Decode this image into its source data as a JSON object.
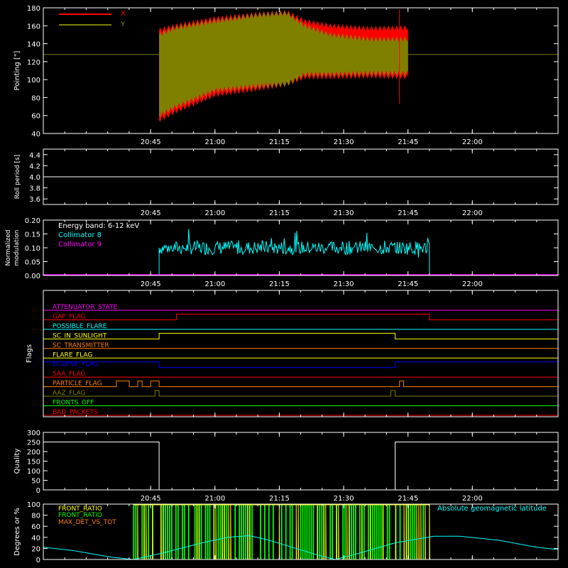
{
  "time_ticks": [
    "20:45",
    "21:00",
    "21:15",
    "21:30",
    "21:45",
    "22:00"
  ],
  "colors": {
    "axis": "#ffffff",
    "pointing_x": "#ff0000",
    "pointing_y": "#808000",
    "collimator_8": "#00ffff",
    "collimator_9": "#ff00ff",
    "front_ratio": "#ffff00",
    "front_ratio_2": "#00ff00",
    "max_det": "#ff8000",
    "geomag": "#00ffff"
  },
  "chart_data": [
    {
      "type": "area",
      "ylabel": "Pointing [\"]",
      "ylim": [
        40,
        180
      ],
      "yticks": [
        "40",
        "60",
        "80",
        "100",
        "120",
        "140",
        "160",
        "180"
      ],
      "legend": [
        "X",
        "Y"
      ],
      "series": [
        {
          "name": "X",
          "envelope_upper": [
            [
              20.783,
              155
            ],
            [
              20.85,
              160
            ],
            [
              21.0,
              168
            ],
            [
              21.17,
              173
            ],
            [
              21.28,
              175
            ],
            [
              21.35,
              165
            ],
            [
              21.45,
              160
            ],
            [
              21.6,
              157
            ],
            [
              21.75,
              158
            ]
          ],
          "envelope_lower": [
            [
              20.783,
              55
            ],
            [
              20.85,
              65
            ],
            [
              21.0,
              83
            ],
            [
              21.17,
              90
            ],
            [
              21.28,
              95
            ],
            [
              21.35,
              103
            ],
            [
              21.45,
              103
            ],
            [
              21.6,
              104
            ],
            [
              21.75,
              103
            ]
          ]
        },
        {
          "name": "Y",
          "envelope_upper": [
            [
              20.783,
              150
            ],
            [
              20.85,
              158
            ],
            [
              21.0,
              165
            ],
            [
              21.17,
              172
            ],
            [
              21.28,
              174
            ],
            [
              21.35,
              160
            ],
            [
              21.45,
              150
            ],
            [
              21.6,
              145
            ],
            [
              21.75,
              145
            ]
          ],
          "envelope_lower": [
            [
              20.783,
              60
            ],
            [
              20.85,
              70
            ],
            [
              21.0,
              88
            ],
            [
              21.17,
              93
            ],
            [
              21.28,
              95
            ],
            [
              21.35,
              106
            ],
            [
              21.45,
              106
            ],
            [
              21.6,
              107
            ],
            [
              21.75,
              107
            ]
          ]
        }
      ],
      "baseline": 128
    },
    {
      "type": "line",
      "ylabel": "Roll period [s]",
      "ylim": [
        3.5,
        4.5
      ],
      "yticks": [
        "3.6",
        "3.8",
        "4.0",
        "4.2",
        "4.4"
      ],
      "value": 4.0
    },
    {
      "type": "line",
      "ylabel": "Normalized modulation",
      "ylim": [
        0.0,
        0.2
      ],
      "yticks": [
        "0.00",
        "0.05",
        "0.10",
        "0.15",
        "0.20"
      ],
      "annotation": "Energy band: 6-12 keV",
      "legend": [
        "Collimator 8",
        "Collimator 9"
      ],
      "range": [
        20.783,
        21.833
      ],
      "mean": 0.1
    },
    {
      "type": "line",
      "ylabel": "Flags",
      "flags": [
        {
          "name": "ATTENUATOR_STATE",
          "color": "#ff00ff",
          "segments": [
            [
              20.333,
              0
            ],
            [
              22.333,
              0
            ]
          ]
        },
        {
          "name": "GAP_FLAG",
          "color": "#ff0000",
          "segments": [
            [
              20.333,
              0
            ],
            [
              20.85,
              0
            ],
            [
              20.85,
              1
            ],
            [
              21.833,
              1
            ],
            [
              21.833,
              0
            ],
            [
              22.333,
              0
            ]
          ]
        },
        {
          "name": "POSSIBLE_FLARE",
          "color": "#00ffff",
          "segments": [
            [
              20.333,
              0
            ],
            [
              22.333,
              0
            ]
          ]
        },
        {
          "name": "SC_IN_SUNLIGHT",
          "color": "#ffff00",
          "segments": [
            [
              20.333,
              0
            ],
            [
              20.783,
              0
            ],
            [
              20.783,
              1
            ],
            [
              21.7,
              1
            ],
            [
              21.7,
              0
            ],
            [
              22.333,
              0
            ]
          ]
        },
        {
          "name": "SC_TRANSMITTER",
          "color": "#ff8000",
          "segments": [
            [
              20.333,
              0
            ],
            [
              22.333,
              0
            ]
          ]
        },
        {
          "name": "FLARE_FLAG",
          "color": "#ffff00",
          "segments": [
            [
              20.333,
              0
            ],
            [
              22.333,
              0
            ]
          ]
        },
        {
          "name": "ECLIPSE_FLAG",
          "color": "#0000ff",
          "segments": [
            [
              20.333,
              1
            ],
            [
              20.783,
              1
            ],
            [
              20.783,
              0
            ],
            [
              21.7,
              0
            ],
            [
              21.7,
              1
            ],
            [
              22.333,
              1
            ]
          ]
        },
        {
          "name": "SAA_FLAG",
          "color": "#ff0000",
          "segments": [
            [
              20.333,
              0
            ],
            [
              22.333,
              0
            ]
          ]
        },
        {
          "name": "PARTICLE_FLAG",
          "color": "#ff8000",
          "segments": [
            [
              20.333,
              0
            ],
            [
              20.617,
              0
            ],
            [
              20.617,
              1
            ],
            [
              20.667,
              1
            ],
            [
              20.667,
              0
            ],
            [
              20.7,
              0
            ],
            [
              20.7,
              1
            ],
            [
              20.717,
              1
            ],
            [
              20.717,
              0
            ],
            [
              20.75,
              0
            ],
            [
              20.75,
              1
            ],
            [
              20.783,
              1
            ],
            [
              20.783,
              0
            ],
            [
              21.717,
              0
            ],
            [
              21.717,
              1
            ],
            [
              21.733,
              1
            ],
            [
              21.733,
              0
            ],
            [
              22.333,
              0
            ]
          ]
        },
        {
          "name": "AAZ_FLAG",
          "color": "#808000",
          "segments": [
            [
              20.333,
              0
            ],
            [
              20.767,
              0
            ],
            [
              20.767,
              1
            ],
            [
              20.783,
              1
            ],
            [
              20.783,
              0
            ],
            [
              21.683,
              0
            ],
            [
              21.683,
              1
            ],
            [
              21.7,
              1
            ],
            [
              21.7,
              0
            ],
            [
              22.333,
              0
            ]
          ]
        },
        {
          "name": "FRONTS_OFF",
          "color": "#00ff00",
          "segments": [
            [
              20.333,
              0
            ],
            [
              22.333,
              0
            ]
          ]
        },
        {
          "name": "BAD_PACKETS",
          "color": "#ff0000",
          "segments": [
            [
              20.333,
              0
            ],
            [
              22.333,
              0
            ]
          ]
        }
      ]
    },
    {
      "type": "line",
      "ylabel": "Quality",
      "ylim": [
        0,
        300
      ],
      "yticks": [
        "0",
        "50",
        "100",
        "150",
        "200",
        "250",
        "300"
      ],
      "points": [
        [
          20.333,
          250
        ],
        [
          20.783,
          250
        ],
        [
          20.783,
          0
        ],
        [
          21.7,
          0
        ],
        [
          21.7,
          250
        ],
        [
          22.333,
          250
        ]
      ]
    },
    {
      "type": "line",
      "ylabel": "Degrees or %",
      "ylim": [
        0,
        100
      ],
      "yticks": [
        "0",
        "20",
        "40",
        "60",
        "80",
        "100"
      ],
      "legend": [
        "FRONT_RATIO",
        "FRONT_RATIO",
        "MAX_DET_VS_TOT"
      ],
      "annotation": "Absolute geomagnetic latitude",
      "range": [
        20.683,
        21.833
      ],
      "geomag": [
        [
          20.333,
          22
        ],
        [
          20.45,
          16
        ],
        [
          20.6,
          4
        ],
        [
          20.683,
          0
        ],
        [
          20.8,
          12
        ],
        [
          20.95,
          30
        ],
        [
          21.05,
          40
        ],
        [
          21.133,
          43
        ],
        [
          21.2,
          36
        ],
        [
          21.3,
          22
        ],
        [
          21.4,
          8
        ],
        [
          21.467,
          0
        ],
        [
          21.55,
          10
        ],
        [
          21.7,
          30
        ],
        [
          21.85,
          42
        ],
        [
          21.95,
          42
        ],
        [
          22.1,
          35
        ],
        [
          22.25,
          22
        ],
        [
          22.333,
          18
        ]
      ]
    }
  ]
}
